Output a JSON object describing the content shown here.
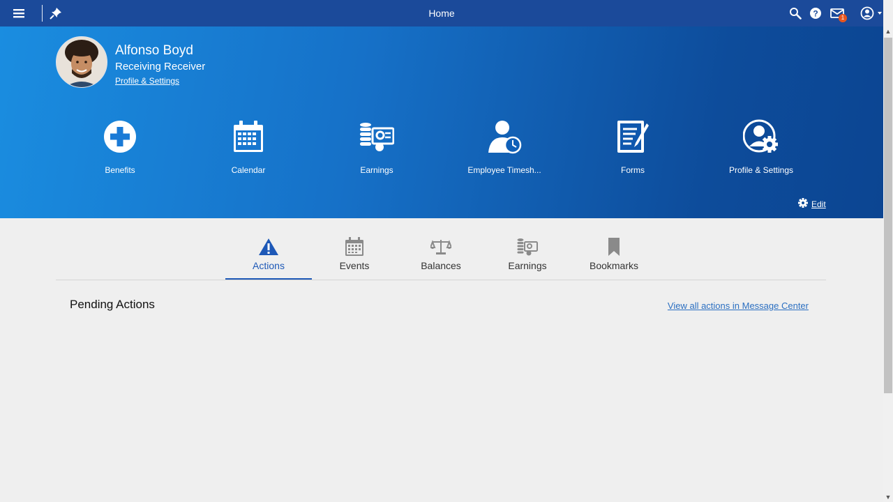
{
  "topbar": {
    "title": "Home",
    "notification_count": "1"
  },
  "user": {
    "name": "Alfonso Boyd",
    "role": "Receiving Receiver",
    "profile_link": "Profile & Settings"
  },
  "tiles": [
    {
      "label": "Benefits",
      "icon": "plus-circle-icon"
    },
    {
      "label": "Calendar",
      "icon": "calendar-icon"
    },
    {
      "label": "Earnings",
      "icon": "earnings-icon"
    },
    {
      "label": "Employee Timesh...",
      "icon": "employee-timesheet-icon"
    },
    {
      "label": "Forms",
      "icon": "forms-icon"
    },
    {
      "label": "Profile & Settings",
      "icon": "profile-settings-icon"
    }
  ],
  "edit_label": "Edit",
  "tabs": [
    {
      "label": "Actions",
      "icon": "warning-icon",
      "active": true
    },
    {
      "label": "Events",
      "icon": "calendar-icon"
    },
    {
      "label": "Balances",
      "icon": "scale-icon"
    },
    {
      "label": "Earnings",
      "icon": "earnings-icon"
    },
    {
      "label": "Bookmarks",
      "icon": "bookmark-icon"
    }
  ],
  "pending": {
    "title": "Pending Actions",
    "view_all_link": "View all actions in Message Center"
  },
  "colors": {
    "topbar": "#1b4a9a",
    "accent": "#1d58b7",
    "link": "#2b6fc1",
    "badge": "#e8561f"
  }
}
